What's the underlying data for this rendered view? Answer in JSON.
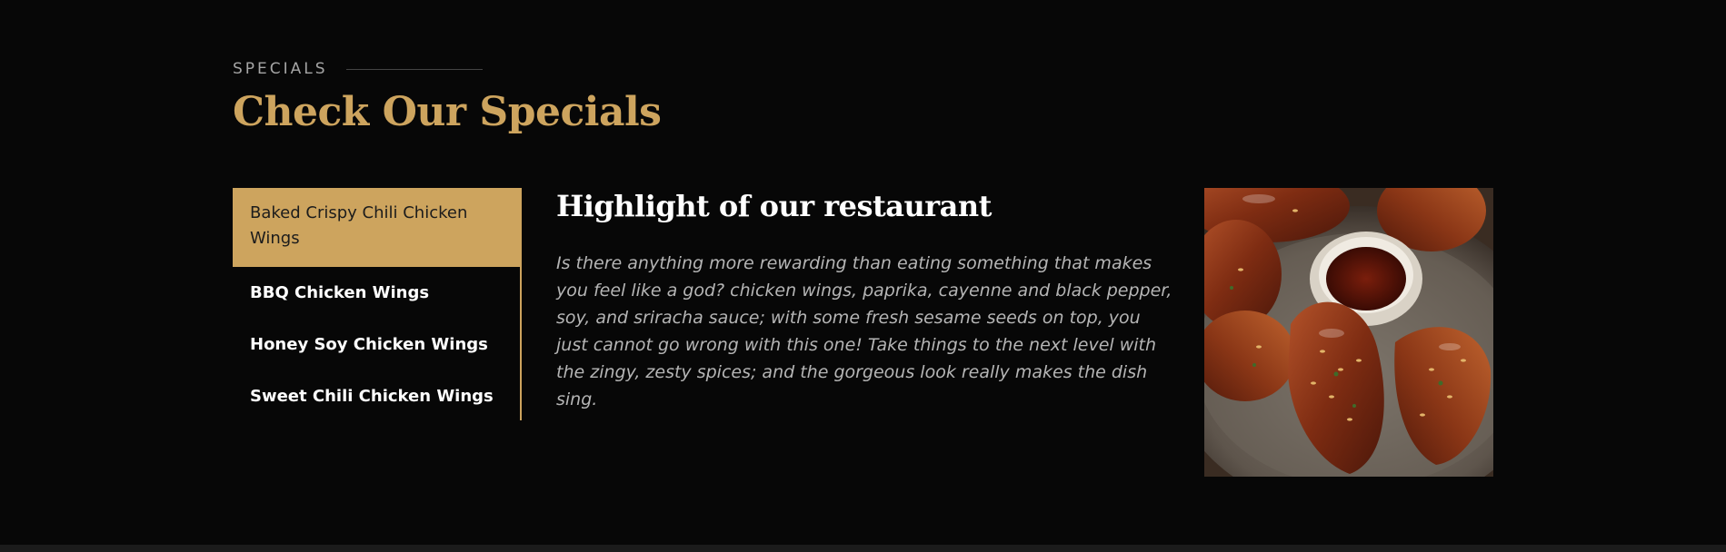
{
  "header": {
    "eyebrow": "SPECIALS",
    "title": "Check Our Specials"
  },
  "tabs": [
    {
      "label": "Baked Crispy Chili Chicken Wings",
      "active": true
    },
    {
      "label": "BBQ Chicken Wings",
      "active": false
    },
    {
      "label": "Honey Soy Chicken Wings",
      "active": false
    },
    {
      "label": "Sweet Chili Chicken Wings",
      "active": false
    }
  ],
  "content": {
    "title": "Highlight of our restaurant",
    "description": "Is there anything more rewarding than eating something that makes you feel like a god? chicken wings, paprika, cayenne and black pepper, soy, and sriracha sauce; with some fresh sesame seeds on top, you just cannot go wrong with this one! Take things to the next level with the zingy, zesty spices; and the gorgeous look really makes the dish sing."
  },
  "colors": {
    "background": "#070707",
    "accent": "#cda45e",
    "text_primary": "#ffffff",
    "text_muted": "#b5b5b5"
  }
}
